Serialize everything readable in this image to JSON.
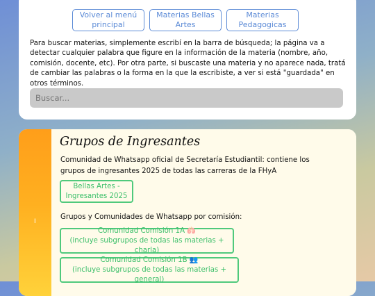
{
  "nav": {
    "buttons": [
      {
        "label": "Volver al menú principal"
      },
      {
        "label": "Materias Bellas Artes"
      },
      {
        "label": "Materias Pedagogicas"
      }
    ]
  },
  "intro": {
    "text": "Para buscar materias, simplemente escribí en la barra de búsqueda; la página va a detectar cualquier palabra que figure en la información de la materia (nombre, año, comisión, docente, etc). Por otra parte, si buscaste una materia y no aparece nada, tratá de cambiar las palabras o la forma en la que la escribiste, a ver si está \"guardada\" en otros términos."
  },
  "search": {
    "placeholder": "Buscar..."
  },
  "section": {
    "side_label": "I",
    "title": "Grupos de Ingresantes",
    "description": "Comunidad de Whatsapp oficial de Secretaría Estudiantil: contiene los grupos de ingresantes 2025 de todas las carreras de la FHyA",
    "bellas_artes_button": "Bellas Artes - Ingresantes 2025",
    "subheading": "Grupos y Comunidades de Whatsapp por comisión:",
    "commission_buttons": [
      {
        "line1": "Comunidad Comisión 1A 🫁",
        "line2": "(incluye subgrupos de todas las materias + charla)"
      },
      {
        "line1": "Comunidad Comisión 1B 👥",
        "line2": "(incluye subgrupos de todas las materias + general)"
      }
    ]
  },
  "colors": {
    "nav_accent": "#5b8ad6",
    "green_accent": "#4fc97c",
    "sidebar_top": "#ff9e1a",
    "sidebar_bottom": "#ffd23a"
  }
}
